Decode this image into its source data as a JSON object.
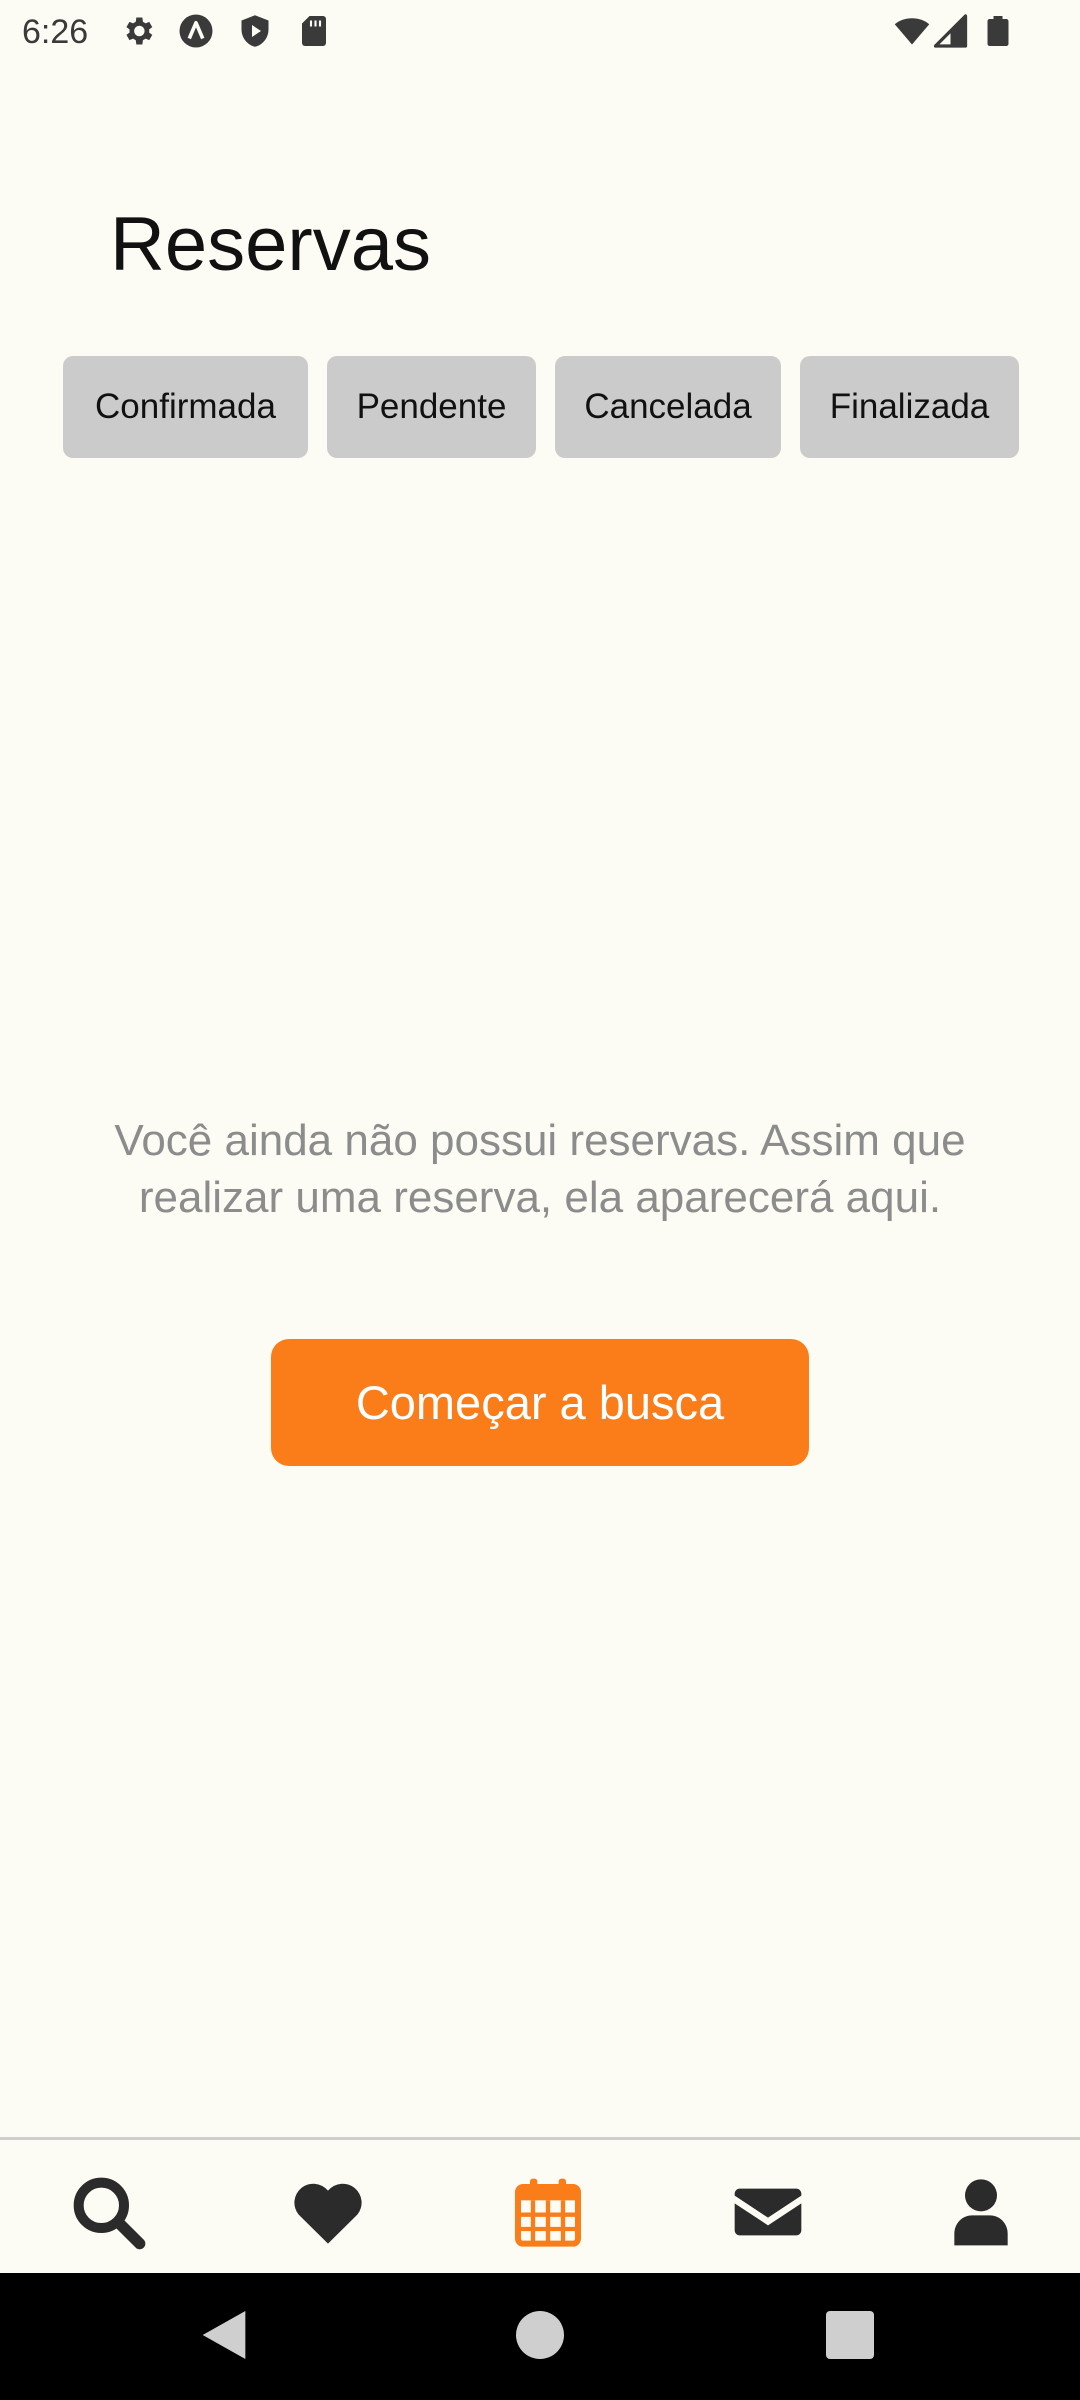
{
  "status_bar": {
    "time": "6:26",
    "left_icons": [
      "gear-icon",
      "a-circle-icon",
      "shield-play-icon",
      "sd-card-icon"
    ],
    "right_icons": [
      "wifi-icon",
      "signal-icon",
      "battery-icon"
    ]
  },
  "page": {
    "title": "Reservas"
  },
  "filters": [
    {
      "label": "Confirmada"
    },
    {
      "label": "Pendente"
    },
    {
      "label": "Cancelada"
    },
    {
      "label": "Finalizada"
    }
  ],
  "empty_state": {
    "message": "Você ainda não possui reservas. Assim que realizar uma reserva, ela aparecerá aqui.",
    "cta_label": "Começar a busca"
  },
  "bottom_nav": {
    "items": [
      {
        "icon": "search-icon",
        "active": false
      },
      {
        "icon": "heart-icon",
        "active": false
      },
      {
        "icon": "calendar-icon",
        "active": true
      },
      {
        "icon": "envelope-icon",
        "active": false
      },
      {
        "icon": "user-icon",
        "active": false
      }
    ]
  },
  "colors": {
    "background": "#fcfcf4",
    "accent": "#fb7d1a",
    "chip_background": "#cbcbcb",
    "nav_inactive": "#2b2b2b",
    "message_text": "#8c8c8c"
  }
}
